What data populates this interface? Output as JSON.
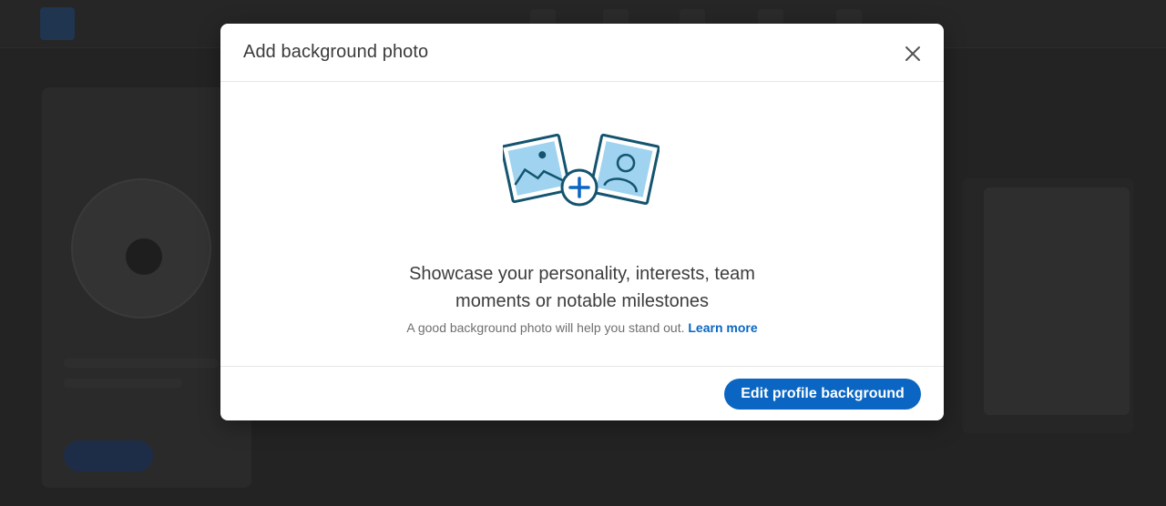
{
  "modal": {
    "title": "Add background photo",
    "close_icon": "close-icon",
    "illustration_icons": [
      "landscape-photo-icon",
      "person-photo-icon",
      "plus-circle-icon"
    ],
    "headline_line1": "Showcase your personality, interests, team",
    "headline_line2": "moments or notable milestones",
    "subtext": "A good background photo will help you stand out.",
    "learn_more_label": "Learn more",
    "primary_button_label": "Edit profile background"
  },
  "colors": {
    "accent": "#0a66c2",
    "overlay": "#1b1b1b",
    "illustration_fill": "#9fd3f0",
    "illustration_stroke": "#14546f"
  }
}
